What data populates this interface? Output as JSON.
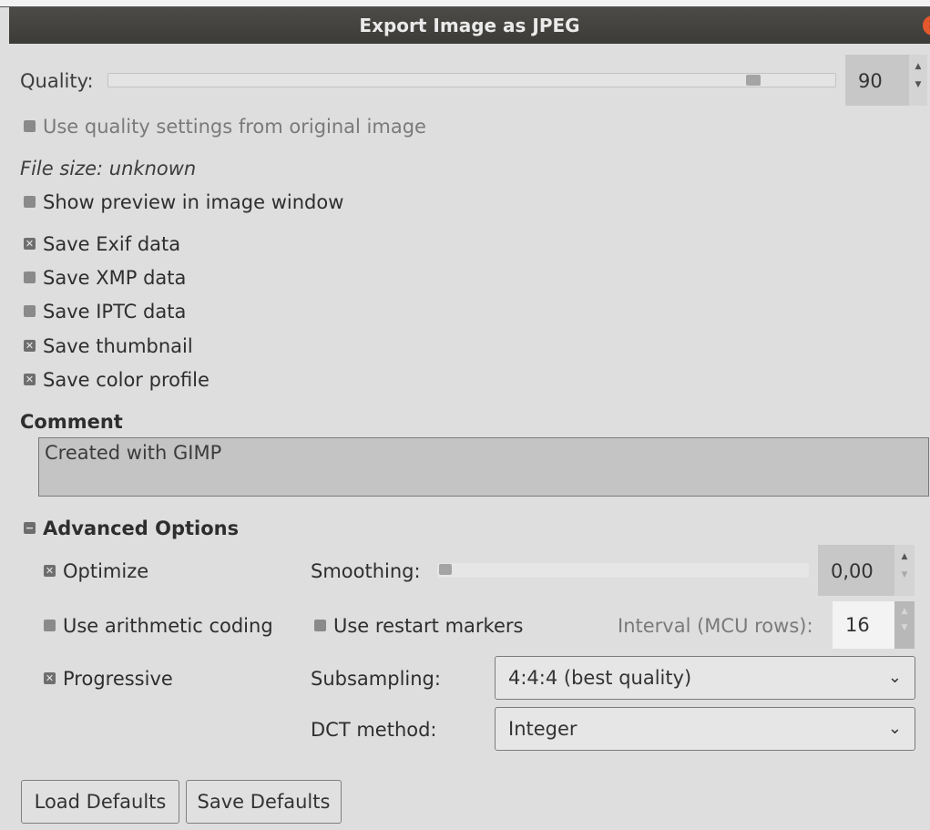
{
  "window": {
    "title": "Export Image as JPEG",
    "close_icon": "close-icon"
  },
  "quality": {
    "label": "Quality:",
    "value": "90",
    "slider_fraction": 0.9
  },
  "checkboxes": {
    "use_original_quality": {
      "label": "Use quality settings from original image",
      "checked": false
    },
    "file_size": "File size: unknown",
    "show_preview": {
      "label": "Show preview in image window",
      "checked": false
    },
    "save_exif": {
      "label": "Save Exif data",
      "checked": true
    },
    "save_xmp": {
      "label": "Save XMP data",
      "checked": false
    },
    "save_iptc": {
      "label": "Save IPTC data",
      "checked": false
    },
    "save_thumbnail": {
      "label": "Save thumbnail",
      "checked": true
    },
    "save_color_profile": {
      "label": "Save color profile",
      "checked": true
    }
  },
  "comment": {
    "heading": "Comment",
    "text": "Created with GIMP"
  },
  "advanced": {
    "heading": "Advanced Options",
    "expanded": true,
    "optimize": {
      "label": "Optimize",
      "checked": true
    },
    "arithmetic": {
      "label": "Use arithmetic coding",
      "checked": false
    },
    "progressive": {
      "label": "Progressive",
      "checked": true
    },
    "smoothing": {
      "label": "Smoothing:",
      "value": "0,00",
      "slider_fraction": 0.0
    },
    "restart_markers": {
      "label": "Use restart markers",
      "checked": false
    },
    "interval": {
      "label": "Interval (MCU rows):",
      "value": "16"
    },
    "subsampling": {
      "label": "Subsampling:",
      "selected": "4:4:4 (best quality)"
    },
    "dct": {
      "label": "DCT method:",
      "selected": "Integer"
    }
  },
  "buttons": {
    "load_defaults": "Load Defaults",
    "save_defaults": "Save Defaults"
  },
  "glyphs": {
    "checked": "✕",
    "collapse": "−",
    "chevron": "⌄",
    "up": "▲",
    "down": "▼",
    "close": "✕"
  }
}
